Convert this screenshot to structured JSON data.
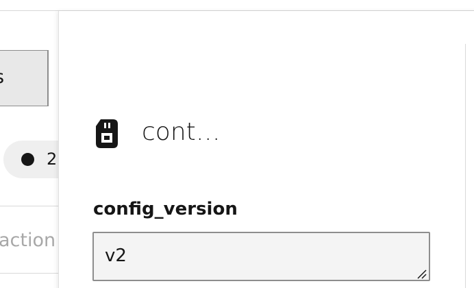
{
  "background": {
    "tab_label": "s",
    "pill_text": "2",
    "field_placeholder": "action"
  },
  "panel": {
    "icon": "sd-card-icon",
    "title": "cont…",
    "field": {
      "label": "config_version",
      "value": "v2"
    }
  }
}
